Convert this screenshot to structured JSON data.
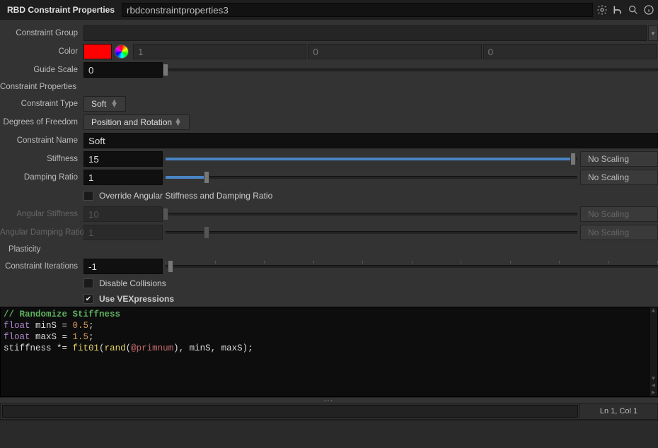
{
  "header": {
    "title": "RBD Constraint Properties",
    "node_name": "rbdconstraintproperties3"
  },
  "labels": {
    "constraint_group": "Constraint Group",
    "color": "Color",
    "guide_scale": "Guide Scale",
    "constraint_properties": "Constraint Properties",
    "constraint_type": "Constraint Type",
    "degrees_of_freedom": "Degrees of Freedom",
    "constraint_name": "Constraint Name",
    "stiffness": "Stiffness",
    "damping_ratio": "Damping Ratio",
    "override_angular": "Override Angular Stiffness and Damping Ratio",
    "angular_stiffness": "Angular Stiffness",
    "angular_damping_ratio": "Angular Damping Ratio",
    "plasticity": "Plasticity",
    "constraint_iterations": "Constraint Iterations",
    "disable_collisions": "Disable Collisions",
    "use_vexpressions": "Use VEXpressions",
    "no_scaling": "No Scaling"
  },
  "values": {
    "color_r": "1",
    "color_g": "0",
    "color_b": "0",
    "color_hex": "#ff0000",
    "guide_scale": "0",
    "constraint_type": "Soft",
    "degrees_of_freedom": "Position and Rotation",
    "constraint_name": "Soft",
    "stiffness": "15",
    "damping_ratio": "1",
    "angular_stiffness": "10",
    "angular_damping_ratio": "1",
    "constraint_iterations": "-1",
    "override_angular_checked": false,
    "disable_collisions_checked": false,
    "use_vexpressions_checked": true
  },
  "slider_pos": {
    "guide_scale": "0%",
    "stiffness_fill": "99%",
    "stiffness_handle": "99%",
    "damping_fill": "10%",
    "damping_handle": "10%",
    "angular_stiffness_handle": "0%",
    "angular_damping_handle": "10%",
    "constraint_iterations_handle": "1%"
  },
  "code": {
    "line1_a": "// Randomize Stiffness",
    "line2_a": "float",
    "line2_b": " minS = ",
    "line2_c": "0.5",
    "line2_d": ";",
    "line3_a": "float",
    "line3_b": " maxS = ",
    "line3_c": "1.5",
    "line3_d": ";",
    "line4_a": "stiffness *= ",
    "line4_b": "fit01",
    "line4_c": "(",
    "line4_d": "rand",
    "line4_e": "(",
    "line4_f": "@primnum",
    "line4_g": "), minS, maxS);"
  },
  "status": {
    "lncol": "Ln 1, Col 1"
  }
}
